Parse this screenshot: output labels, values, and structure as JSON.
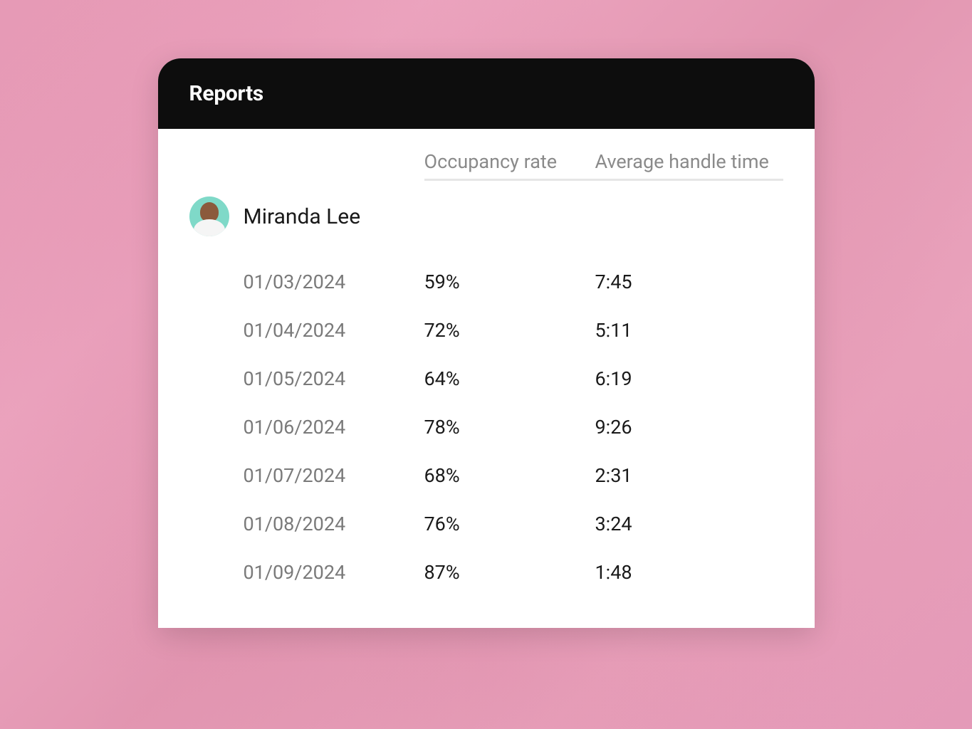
{
  "header": {
    "title": "Reports"
  },
  "columns": {
    "occupancy": "Occupancy rate",
    "aht": "Average handle time"
  },
  "agent": {
    "name": "Miranda Lee"
  },
  "rows": [
    {
      "date": "01/03/2024",
      "occupancy": "59%",
      "aht": "7:45"
    },
    {
      "date": "01/04/2024",
      "occupancy": "72%",
      "aht": "5:11"
    },
    {
      "date": "01/05/2024",
      "occupancy": "64%",
      "aht": "6:19"
    },
    {
      "date": "01/06/2024",
      "occupancy": "78%",
      "aht": "9:26"
    },
    {
      "date": "01/07/2024",
      "occupancy": "68%",
      "aht": "2:31"
    },
    {
      "date": "01/08/2024",
      "occupancy": "76%",
      "aht": "3:24"
    },
    {
      "date": "01/09/2024",
      "occupancy": "87%",
      "aht": "1:48"
    }
  ]
}
